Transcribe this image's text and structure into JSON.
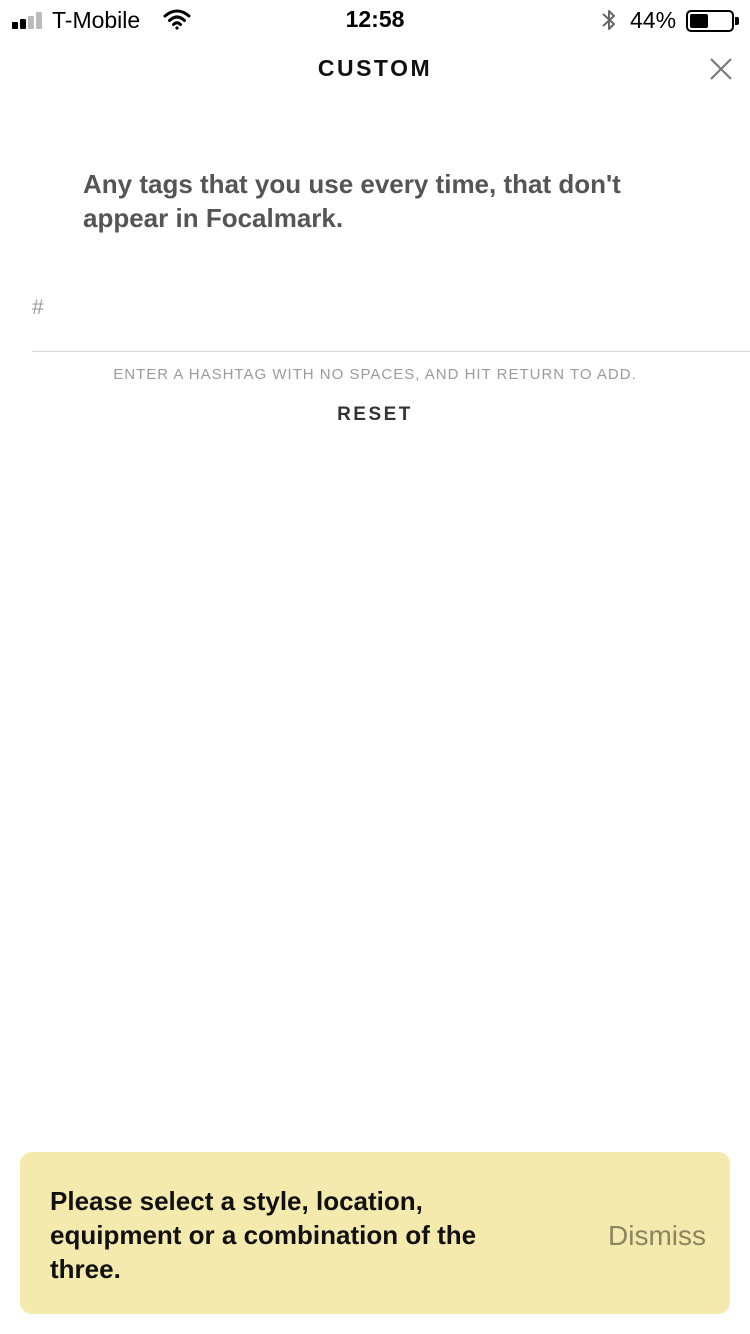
{
  "status_bar": {
    "carrier": "T-Mobile",
    "time": "12:58",
    "battery_percent": "44%",
    "battery_level": 0.44,
    "signal_bars": 2,
    "icons": [
      "signal-icon",
      "wifi-icon",
      "bluetooth-icon",
      "battery-icon"
    ]
  },
  "header": {
    "title": "CUSTOM",
    "close_icon": "close-icon"
  },
  "main": {
    "description": "Any tags that you use every time, that don't appear in Focalmark.",
    "input": {
      "prefix": "#",
      "value": "",
      "placeholder": ""
    },
    "hint": "ENTER A HASHTAG WITH NO SPACES, AND HIT RETURN TO ADD.",
    "reset_label": "RESET"
  },
  "toast": {
    "message": "Please select a style, location, equipment or a combination of the three.",
    "dismiss_label": "Dismiss"
  },
  "colors": {
    "toast_background": "#f5eaae",
    "description_text": "#555555",
    "hint_text": "#9b9b9b",
    "divider": "#d6d6d6"
  }
}
